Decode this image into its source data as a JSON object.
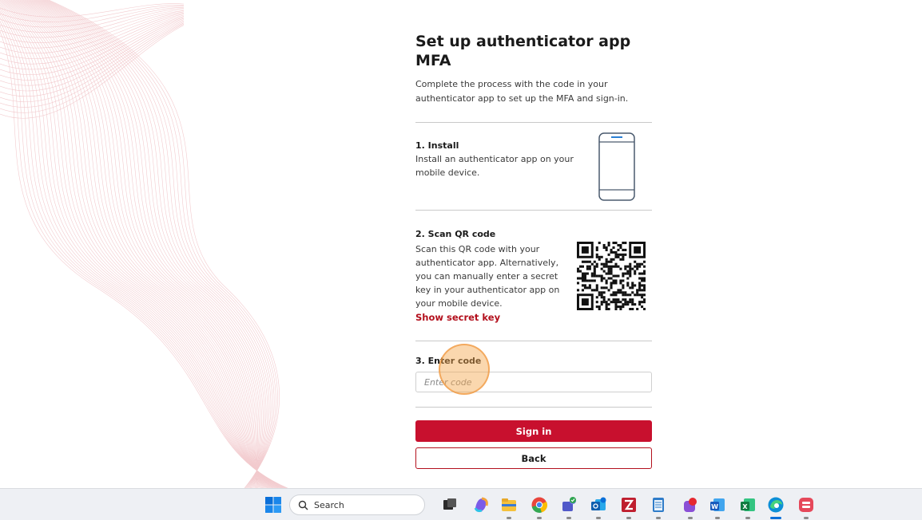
{
  "page": {
    "title": "Set up authenticator app MFA",
    "subtitle": "Complete the process with the code in your authenticator app to set up the MFA and sign-in."
  },
  "steps": {
    "install": {
      "title": "1. Install",
      "text": "Install an authenticator app on your mobile device."
    },
    "scan": {
      "title": "2. Scan QR code",
      "text": "Scan this QR code with your authenticator app. Alternatively, you can manually enter a secret key in your authenticator app on your mobile device.",
      "link": "Show secret key"
    },
    "enter": {
      "title": "3. Enter code",
      "placeholder": "Enter code",
      "value": ""
    }
  },
  "buttons": {
    "sign_in": "Sign in",
    "back": "Back"
  },
  "taskbar": {
    "search_label": "Search",
    "apps": [
      "start-icon",
      "task-view-icon",
      "copilot-icon",
      "file-explorer-icon",
      "chrome-icon",
      "teams-icon",
      "outlook-icon",
      "filezilla-icon",
      "notepad-icon",
      "app-icon",
      "word-icon",
      "excel-icon",
      "edge-icon",
      "app-red-icon"
    ]
  },
  "colors": {
    "brand_red": "#c8102e",
    "link_red": "#b3101d",
    "cursor_halo": "#f5a64c"
  }
}
